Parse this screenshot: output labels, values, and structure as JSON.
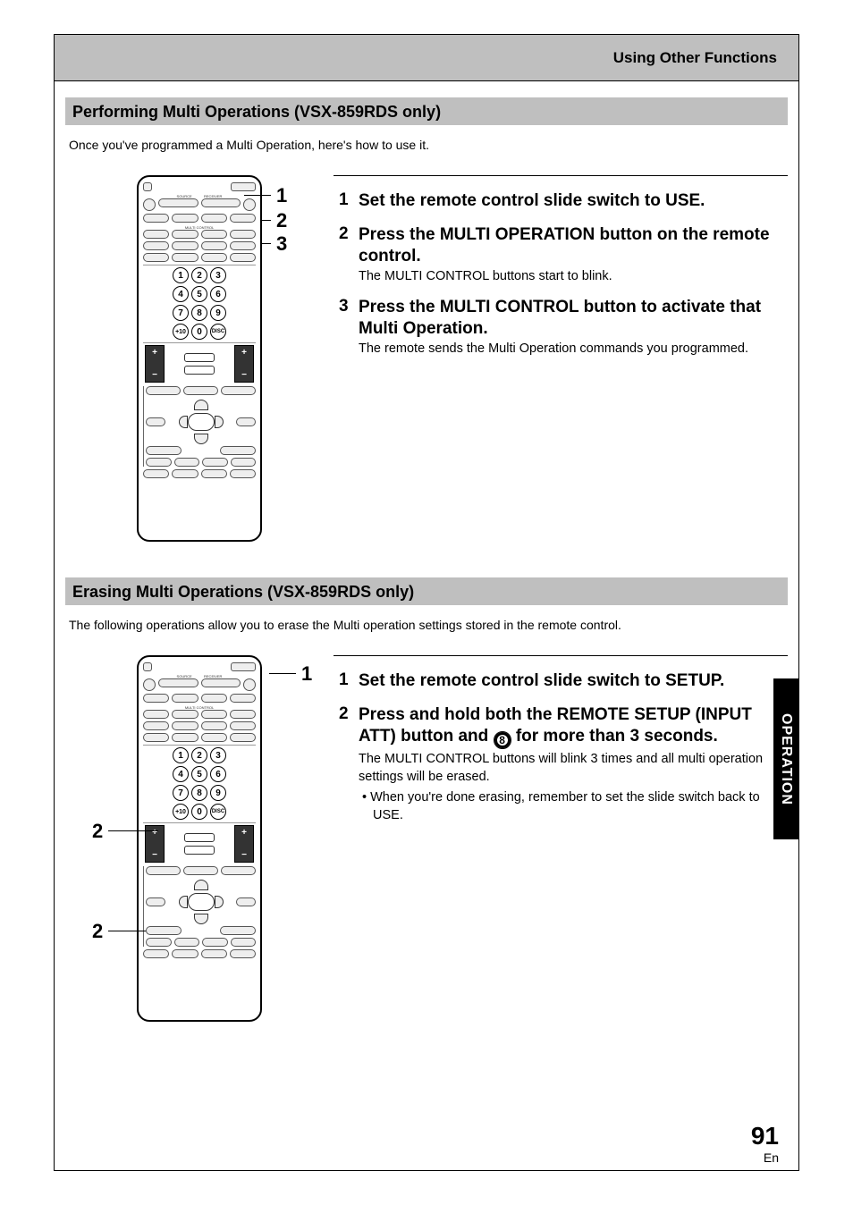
{
  "header": {
    "chapter": "Using Other Functions"
  },
  "section1": {
    "title": "Performing Multi Operations (VSX-859RDS only)",
    "intro": "Once you've programmed a Multi Operation, here's how to use it.",
    "callouts": {
      "c1": "1",
      "c2": "2",
      "c3": "3"
    },
    "steps": [
      {
        "num": "1",
        "title": "Set the remote control slide switch to USE.",
        "desc": ""
      },
      {
        "num": "2",
        "title": "Press the MULTI OPERATION button on the remote control.",
        "desc": "The MULTI CONTROL buttons start to blink."
      },
      {
        "num": "3",
        "title": "Press the MULTI CONTROL button to activate that Multi Operation.",
        "desc": "The remote sends the Multi Operation commands you programmed."
      }
    ]
  },
  "section2": {
    "title": "Erasing Multi Operations (VSX-859RDS only)",
    "intro": "The following operations allow you to erase the Multi operation settings stored in the remote control.",
    "callouts": {
      "c1": "1",
      "c2a": "2",
      "c2b": "2"
    },
    "steps": [
      {
        "num": "1",
        "title": "Set the remote control slide switch to SETUP.",
        "desc": ""
      },
      {
        "num": "2",
        "title_pre": "Press and hold both the REMOTE SETUP (INPUT ATT) button and ",
        "title_post": " for more than 3 seconds.",
        "desc": "The MULTI CONTROL buttons will blink 3 times and all multi operation settings will be erased.",
        "bullet": "When you're done erasing, remember to set the slide switch back to USE."
      }
    ]
  },
  "sidetab": "OPERATION",
  "footer": {
    "page": "91",
    "lang": "En"
  }
}
